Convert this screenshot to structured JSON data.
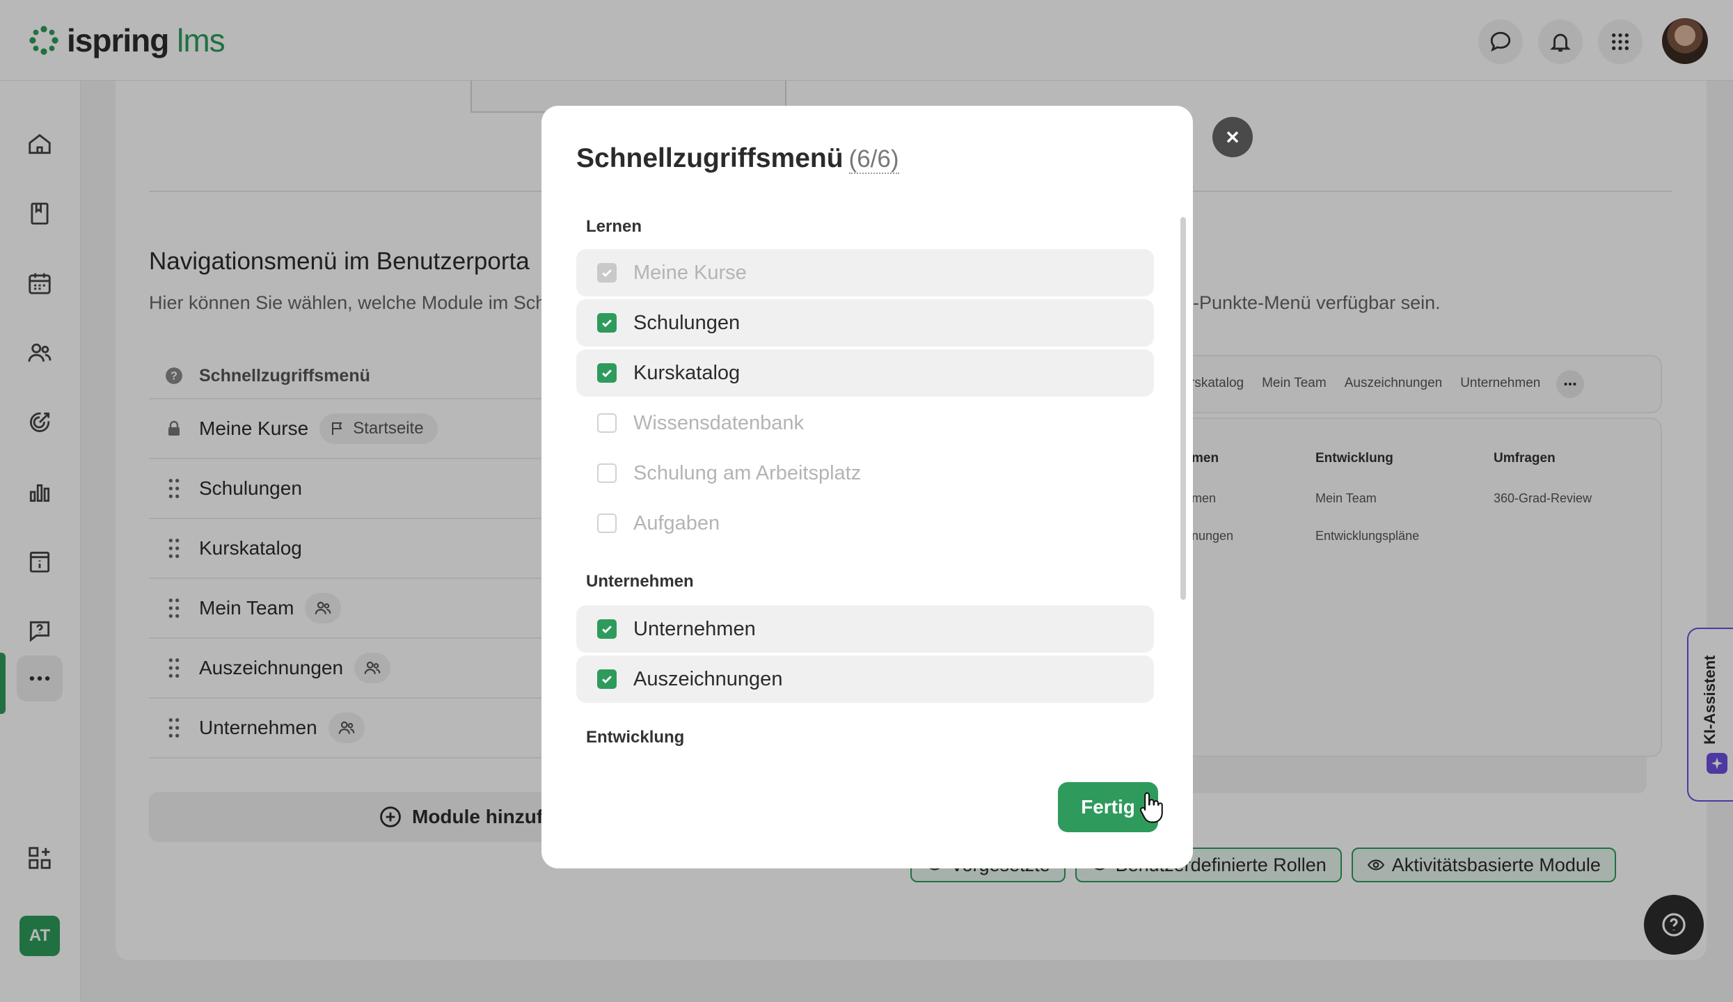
{
  "brand": {
    "name": "ispring",
    "suffix": "lms",
    "accent": "#2e9b5c"
  },
  "topbar": {
    "icons": [
      "chat-icon",
      "bell-icon",
      "apps-grid-icon"
    ]
  },
  "sidebar": {
    "items": [
      "home-icon",
      "book-icon",
      "calendar-icon",
      "people-icon",
      "target-icon",
      "chart-icon",
      "info-board-icon",
      "help-chat-icon",
      "more-icon"
    ],
    "active": "more-icon",
    "bottom_icon": "widgets-icon",
    "avatar_initials": "AT"
  },
  "page": {
    "section_title": "Navigationsmenü im Benutzerporta",
    "section_desc": "Hier können Sie wählen, welche Module im Sch",
    "section_desc_tail": "i-Punkte-Menü verfügbar sein.",
    "table_header": "Schnellzugriffsmenü",
    "rows": [
      {
        "label": "Meine Kurse",
        "chip": "Startseite",
        "locked": true
      },
      {
        "label": "Schulungen"
      },
      {
        "label": "Kurskatalog"
      },
      {
        "label": "Mein Team",
        "chip_icon": "people-icon"
      },
      {
        "label": "Auszeichnungen",
        "chip_icon": "people-icon"
      },
      {
        "label": "Unternehmen",
        "chip_icon": "people-icon"
      }
    ],
    "add_module": "Module hinzufü",
    "role_chips": [
      "Vorgesetzte",
      "Benutzerdefinierte Rollen",
      "Aktivitätsbasierte Module"
    ]
  },
  "preview": {
    "nav": [
      "rskatalog",
      "Mein Team",
      "Auszeichnungen",
      "Unternehmen"
    ],
    "columns": [
      {
        "head": "men",
        "items": [
          "men",
          "nungen"
        ]
      },
      {
        "head": "Entwicklung",
        "items": [
          "Mein Team",
          "Entwicklungspläne"
        ]
      },
      {
        "head": "Umfragen",
        "items": [
          "360-Grad-Review"
        ]
      }
    ]
  },
  "ai_assistant": {
    "label": "KI-Assistent",
    "color": "#6b4fe0"
  },
  "modal": {
    "title": "Schnellzugriffsmenü",
    "count": "(6/6)",
    "groups": [
      {
        "label": "Lernen",
        "options": [
          {
            "label": "Meine Kurse",
            "state": "locked"
          },
          {
            "label": "Schulungen",
            "state": "on"
          },
          {
            "label": "Kurskatalog",
            "state": "on"
          },
          {
            "label": "Wissensdatenbank",
            "state": "off"
          },
          {
            "label": "Schulung am Arbeitsplatz",
            "state": "off"
          },
          {
            "label": "Aufgaben",
            "state": "off"
          }
        ]
      },
      {
        "label": "Unternehmen",
        "options": [
          {
            "label": "Unternehmen",
            "state": "on"
          },
          {
            "label": "Auszeichnungen",
            "state": "on"
          }
        ]
      },
      {
        "label": "Entwicklung",
        "options": []
      }
    ],
    "done_label": "Fertig"
  }
}
